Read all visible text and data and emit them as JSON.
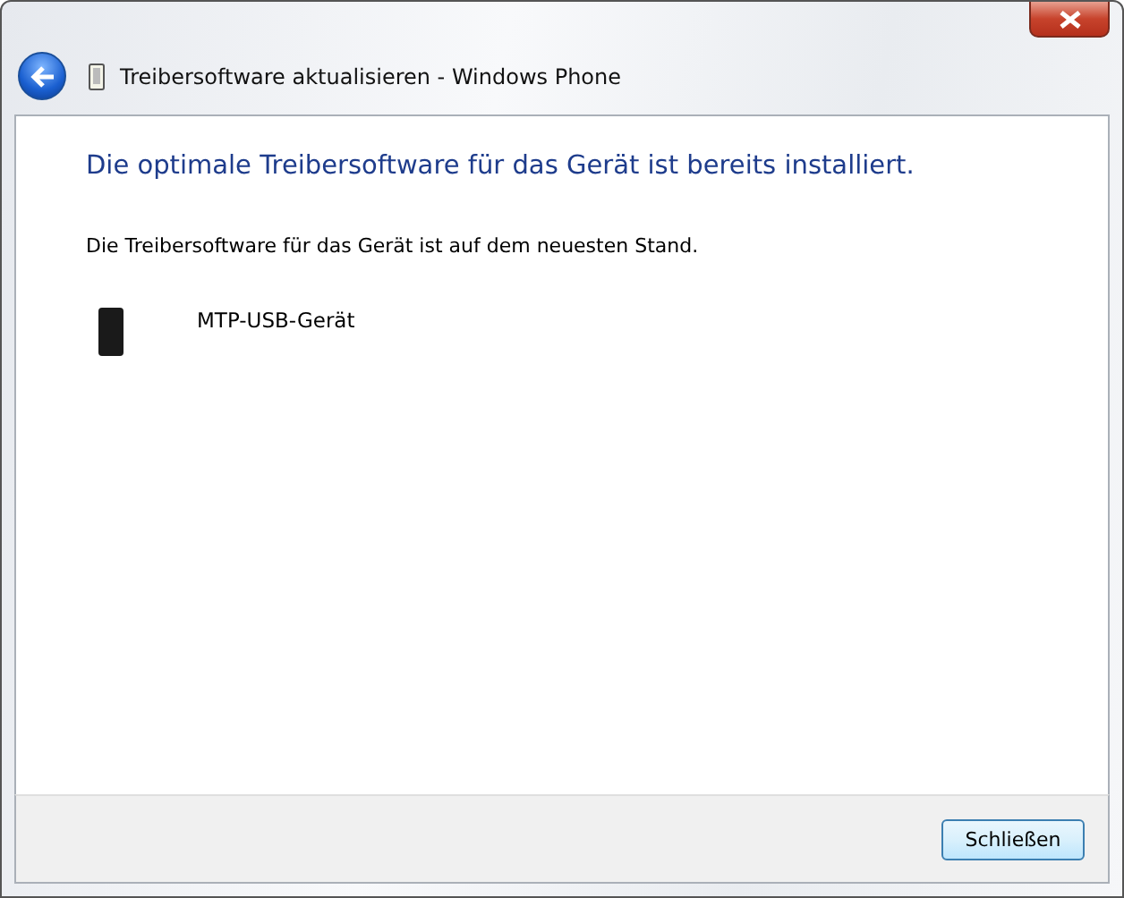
{
  "window": {
    "title": "Treibersoftware aktualisieren - Windows Phone"
  },
  "heading": "Die optimale Treibersoftware für das Gerät ist bereits installiert.",
  "message": "Die Treibersoftware für das Gerät ist auf dem neuesten Stand.",
  "device": {
    "name": "MTP-USB-Gerät"
  },
  "buttons": [
    "Schließen"
  ]
}
